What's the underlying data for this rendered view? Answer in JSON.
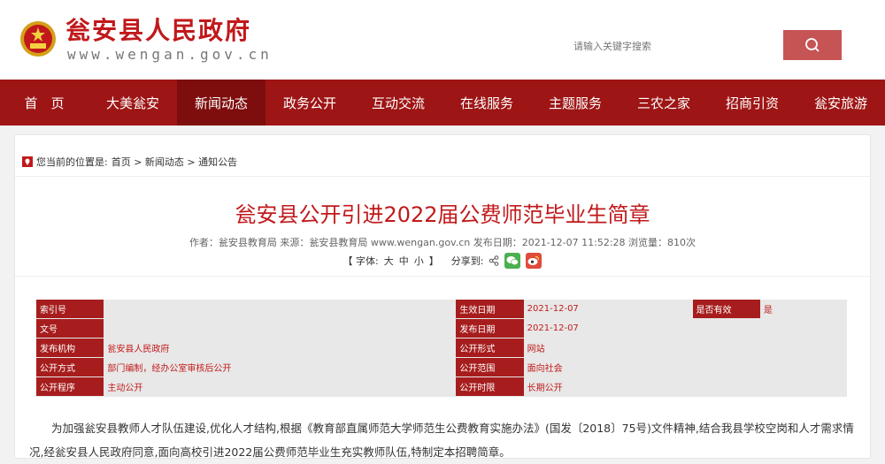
{
  "header": {
    "site_title": "瓮安县人民政府",
    "site_url": "www.wengan.gov.cn",
    "search_placeholder": "请输入关键字搜索"
  },
  "nav": {
    "items": [
      {
        "label": "首　页"
      },
      {
        "label": "大美瓮安"
      },
      {
        "label": "新闻动态"
      },
      {
        "label": "政务公开"
      },
      {
        "label": "互动交流"
      },
      {
        "label": "在线服务"
      },
      {
        "label": "主题服务"
      },
      {
        "label": "三农之家"
      },
      {
        "label": "招商引资"
      },
      {
        "label": "瓮安旅游"
      }
    ],
    "active_index": 2
  },
  "breadcrumb": {
    "prefix": "您当前的位置是:",
    "path": "首页 > 新闻动态 > 通知公告"
  },
  "article": {
    "title": "瓮安县公开引进2022届公费师范毕业生简章",
    "meta": "作者：瓮安县教育局 来源：瓮安县教育局 www.wengan.gov.cn 发布日期：2021-12-07 11:52:28 浏览量：810次",
    "font_prefix": "【 字体:",
    "font_large": "大",
    "font_medium": "中",
    "font_small": "小",
    "font_suffix": "】",
    "share_label": "分享到:",
    "paragraph": "　　为加强瓮安县教师人才队伍建设,优化人才结构,根据《教育部直属师范大学师范生公费教育实施办法》(国发〔2018〕75号)文件精神,结合我县学校空岗和人才需求情况,经瓮安县人民政府同意,面向高校引进2022届公费师范毕业生充实教师队伍,特制定本招聘简章。"
  },
  "info": {
    "suoyinhao_key": "索引号",
    "suoyinhao_val": "",
    "shengxiao_key": "生效日期",
    "shengxiao_val": "2021-12-07",
    "youxiao_key": "是否有效",
    "youxiao_val": "是",
    "wenhao_key": "文号",
    "wenhao_val": "",
    "fabu_key": "发布日期",
    "fabu_val": "2021-12-07",
    "jigou_key": "发布机构",
    "jigou_val": "瓮安县人民政府",
    "xingshi_key": "公开形式",
    "xingshi_val": "网站",
    "fangshi_key": "公开方式",
    "fangshi_val": "部门编制，经办公室审核后公开",
    "fanwei_key": "公开范围",
    "fanwei_val": "面向社会",
    "chengxu_key": "公开程序",
    "chengxu_val": "主动公开",
    "shixian_key": "公开时限",
    "shixian_val": "长期公开"
  },
  "colors": {
    "brand_red": "#9e1515",
    "title_red": "#c1191b",
    "search_button": "#c65454"
  }
}
